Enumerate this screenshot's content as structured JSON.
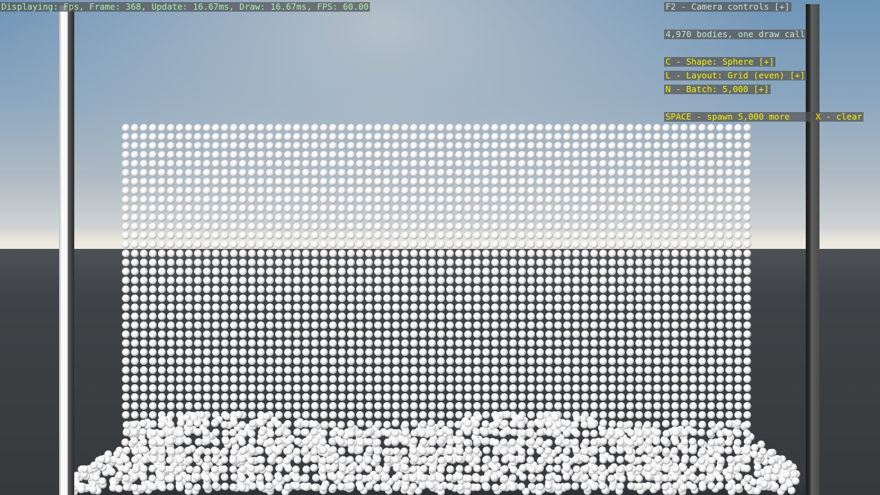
{
  "hud": {
    "stats": "Displaying: Fps, Frame: 368, Update: 16.67ms, Draw: 16.67ms, FPS: 60.00",
    "camera_controls": "F2 - Camera controls [+]",
    "body_count": "4,970 bodies, one draw call",
    "shape": "C - Shape: Sphere [+]",
    "layout": "L - Layout: Grid (even) [+]",
    "batch": "N - Batch: 5,000 [+]",
    "spawn": "SPACE - spawn 5,000 more",
    "clear": "X - clear"
  },
  "scene": {
    "body_color": "#f2f2f2",
    "body_shadow_color": "#9a9a9a",
    "sky_top_color": "#6f95b8",
    "ground_color": "#3f4246",
    "wall_left_color": "#f3f3f3",
    "wall_right_color": "#2e2e2e"
  }
}
